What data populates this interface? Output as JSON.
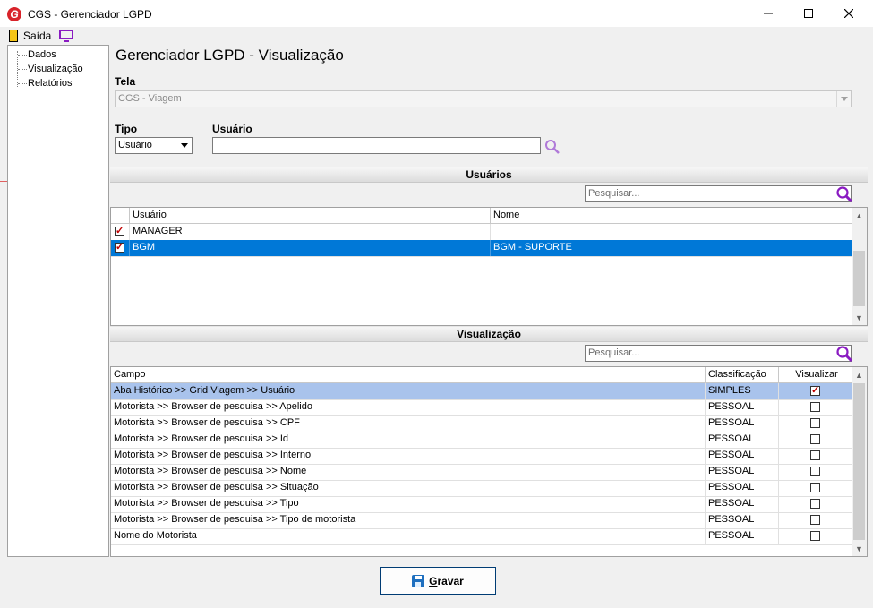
{
  "window": {
    "title": "CGS - Gerenciador LGPD",
    "logo_letter": "G"
  },
  "menu": {
    "exit_label": "Saída"
  },
  "tree": {
    "items": [
      "Dados",
      "Visualização",
      "Relatórios"
    ]
  },
  "page": {
    "title": "Gerenciador LGPD - Visualização"
  },
  "form": {
    "tela_label": "Tela",
    "tela_value": "CGS - Viagem",
    "tipo_label": "Tipo",
    "tipo_value": "Usuário",
    "usuario_label": "Usuário",
    "usuario_value": ""
  },
  "users_section": {
    "title": "Usuários",
    "search_placeholder": "Pesquisar...",
    "columns": [
      "Usuário",
      "Nome"
    ],
    "rows": [
      {
        "user": "MANAGER",
        "name": "",
        "checked": true,
        "selected": false
      },
      {
        "user": "BGM",
        "name": "BGM - SUPORTE",
        "checked": true,
        "selected": true
      }
    ]
  },
  "view_section": {
    "title": "Visualização",
    "search_placeholder": "Pesquisar...",
    "columns": [
      "Campo",
      "Classificação",
      "Visualizar"
    ],
    "rows": [
      {
        "campo": "Aba Histórico >> Grid Viagem >> Usuário",
        "class": "SIMPLES",
        "visualizar": true
      },
      {
        "campo": "Motorista >> Browser de pesquisa >> Apelido",
        "class": "PESSOAL",
        "visualizar": false
      },
      {
        "campo": "Motorista >> Browser de pesquisa >> CPF",
        "class": "PESSOAL",
        "visualizar": false
      },
      {
        "campo": "Motorista >> Browser de pesquisa >> Id",
        "class": "PESSOAL",
        "visualizar": false
      },
      {
        "campo": "Motorista >> Browser de pesquisa >> Interno",
        "class": "PESSOAL",
        "visualizar": false
      },
      {
        "campo": "Motorista >> Browser de pesquisa >> Nome",
        "class": "PESSOAL",
        "visualizar": false
      },
      {
        "campo": "Motorista >> Browser de pesquisa >> Situação",
        "class": "PESSOAL",
        "visualizar": false
      },
      {
        "campo": "Motorista >> Browser de pesquisa >> Tipo",
        "class": "PESSOAL",
        "visualizar": false
      },
      {
        "campo": "Motorista >> Browser de pesquisa >> Tipo de motorista",
        "class": "PESSOAL",
        "visualizar": false
      },
      {
        "campo": "Nome do Motorista",
        "class": "PESSOAL",
        "visualizar": false
      }
    ]
  },
  "buttons": {
    "save_prefix": "G",
    "save_rest": "ravar"
  },
  "colors": {
    "selected_row": "#0078d7",
    "highlight_row": "#a9c3ec",
    "search_icon": "#8a1bc2",
    "logo": "#d8232a"
  },
  "icons": {
    "exit": "exit-door-icon",
    "monitor": "monitor-icon",
    "search": "search-icon",
    "save": "floppy-disk-icon"
  }
}
